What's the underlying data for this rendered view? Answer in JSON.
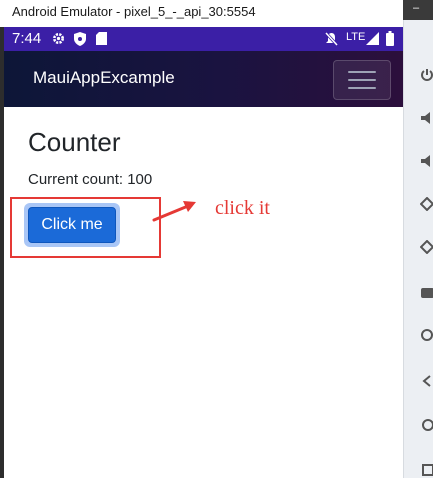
{
  "window": {
    "title": "Android Emulator - pixel_5_-_api_30:5554"
  },
  "status_bar": {
    "time": "7:44",
    "network": "LTE",
    "icons_left": [
      "gear-icon",
      "shield-icon",
      "sd-card-icon"
    ],
    "icons_right": [
      "mute-icon",
      "lte-signal-icon",
      "battery-icon"
    ]
  },
  "app_bar": {
    "title": "MauiAppExcample",
    "menu_icon": "hamburger-menu-icon"
  },
  "page": {
    "heading": "Counter",
    "count_text": "Current count: 100",
    "button_label": "Click me"
  },
  "annotation": {
    "note": "click it",
    "color": "#e53935"
  },
  "emulator_toolbar": {
    "icons": [
      "power-icon",
      "volume-up-icon",
      "volume-down-icon",
      "rotate-left-icon",
      "rotate-right-icon",
      "camera-icon",
      "zoom-icon",
      "back-icon",
      "home-icon",
      "overview-icon"
    ]
  },
  "colors": {
    "status_bar": "#3b1fa6",
    "app_bar_start": "#0d1638",
    "app_bar_end": "#2c0f3c",
    "button": "#1b6ad8",
    "annotation": "#e53935"
  }
}
